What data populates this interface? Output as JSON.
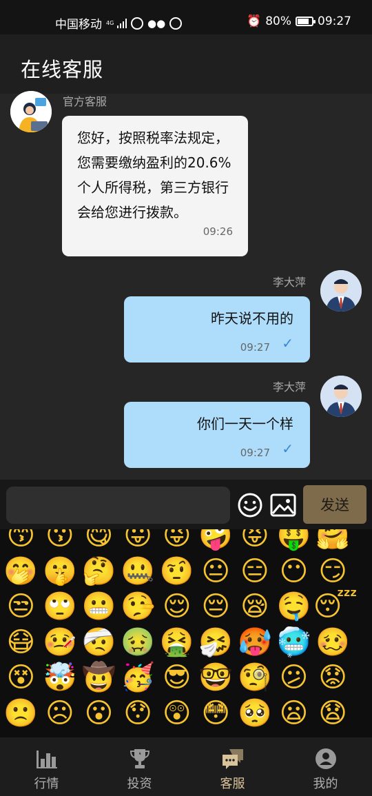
{
  "status_bar": {
    "carrier": "中国移动",
    "network": "4G",
    "battery_percent": "80%",
    "battery_level": 0.8,
    "time": "09:27"
  },
  "header": {
    "title": "在线客服"
  },
  "messages": [
    {
      "sender": "官方客服",
      "text": "您好，按照税率法规定，您需要缴纳盈利的20.6%个人所得税，第三方银行会给您进行拨款。",
      "time": "09:26",
      "direction": "incoming"
    },
    {
      "sender": "李大萍",
      "text": "昨天说不用的",
      "time": "09:27",
      "direction": "outgoing"
    },
    {
      "sender": "李大萍",
      "text": "你们一天一个样",
      "time": "09:27",
      "direction": "outgoing"
    }
  ],
  "composer": {
    "input_value": "",
    "send_label": "发送"
  },
  "emoji_icons": [
    "kissing-closed-eyes",
    "kissing",
    "yum",
    "tongue-out",
    "winking-tongue",
    "zany",
    "squinting-tongue",
    "money-mouth",
    "hugging",
    "hand-over-mouth",
    "shushing",
    "thinking",
    "zipper-mouth",
    "raised-eyebrow",
    "neutral",
    "expressionless",
    "no-mouth",
    "smirk",
    "unamused",
    "rolling-eyes",
    "grimacing",
    "lying",
    "relieved",
    "pensive",
    "sleepy",
    "drooling",
    "sleeping",
    "medical-mask",
    "thermometer",
    "head-bandage",
    "nauseated",
    "vomiting",
    "sneezing",
    "hot",
    "cold",
    "woozy",
    "dizzy",
    "exploding-head",
    "cowboy",
    "partying",
    "sunglasses",
    "nerd",
    "monocle",
    "confused",
    "worried",
    "slightly-frowning",
    "frowning",
    "open-mouth",
    "hushed",
    "astonished",
    "flushed",
    "pleading",
    "frowning-open",
    "anguished"
  ],
  "tabs": [
    {
      "label": "行情",
      "icon": "chart-icon",
      "active": false
    },
    {
      "label": "投资",
      "icon": "trophy-icon",
      "active": false
    },
    {
      "label": "客服",
      "icon": "chat-icon",
      "active": true
    },
    {
      "label": "我的",
      "icon": "user-icon",
      "active": false
    }
  ],
  "colors": {
    "accent": "#d9c39b",
    "send_button": "#7e6b4b",
    "outgoing_bubble": "#aeddfb",
    "incoming_bubble": "#f4f4f4"
  }
}
